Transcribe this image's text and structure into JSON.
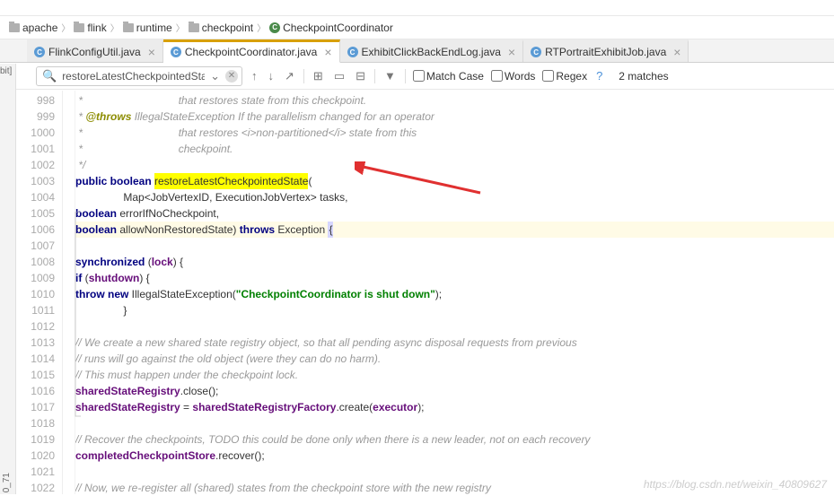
{
  "breadcrumbs": {
    "items": [
      {
        "label": "apache",
        "icon": "folder"
      },
      {
        "label": "flink",
        "icon": "folder"
      },
      {
        "label": "runtime",
        "icon": "folder"
      },
      {
        "label": "checkpoint",
        "icon": "folder"
      },
      {
        "label": "CheckpointCoordinator",
        "icon": "class"
      }
    ]
  },
  "tabs": [
    {
      "label": "FlinkConfigUtil.java",
      "active": false
    },
    {
      "label": "CheckpointCoordinator.java",
      "active": true
    },
    {
      "label": "ExhibitClickBackEndLog.java",
      "active": false
    },
    {
      "label": "RTPortraitExhibitJob.java",
      "active": false
    }
  ],
  "search": {
    "value": "restoreLatestCheckpointedState",
    "match_case_label": "Match Case",
    "words_label": "Words",
    "regex_label": "Regex",
    "matches_label": "2 matches"
  },
  "left_strip_label": "0_71",
  "bit_label": "bit]",
  "lines": [
    {
      "n": "998",
      "indent": 8,
      "tokens": [
        {
          "cls": "c-comment",
          "t": " *                                that restores state from this checkpoint."
        }
      ]
    },
    {
      "n": "999",
      "indent": 8,
      "tokens": [
        {
          "cls": "c-comment",
          "t": " * "
        },
        {
          "cls": "c-tag",
          "t": "@throws"
        },
        {
          "cls": "c-comment",
          "t": " IllegalStateException If the parallelism changed for an operator"
        }
      ]
    },
    {
      "n": "1000",
      "indent": 8,
      "tokens": [
        {
          "cls": "c-comment",
          "t": " *                                that restores <i>non-partitioned</i> state from this"
        }
      ]
    },
    {
      "n": "1001",
      "indent": 8,
      "tokens": [
        {
          "cls": "c-comment",
          "t": " *                                checkpoint."
        }
      ]
    },
    {
      "n": "1002",
      "indent": 8,
      "tokens": [
        {
          "cls": "c-comment",
          "t": " */"
        }
      ]
    },
    {
      "n": "1003",
      "indent": 8,
      "tokens": [
        {
          "cls": "c-kw",
          "t": "public boolean "
        },
        {
          "cls": "c-hl",
          "t": "restoreLatestCheckpointedState"
        },
        {
          "cls": "",
          "t": "("
        }
      ]
    },
    {
      "n": "1004",
      "indent": 16,
      "tokens": [
        {
          "cls": "",
          "t": "Map<JobVertexID, ExecutionJobVertex> tasks,"
        }
      ]
    },
    {
      "n": "1005",
      "indent": 16,
      "tokens": [
        {
          "cls": "c-kw",
          "t": "boolean"
        },
        {
          "cls": "",
          "t": " errorIfNoCheckpoint,"
        }
      ]
    },
    {
      "n": "1006",
      "indent": 16,
      "hl": true,
      "tokens": [
        {
          "cls": "c-kw",
          "t": "boolean"
        },
        {
          "cls": "",
          "t": " allowNonRestoredState) "
        },
        {
          "cls": "c-kw",
          "t": "throws"
        },
        {
          "cls": "",
          "t": " Exception "
        },
        {
          "cls": "c-paren-hl",
          "t": "{"
        }
      ]
    },
    {
      "n": "1007",
      "indent": 0,
      "tokens": []
    },
    {
      "n": "1008",
      "indent": 12,
      "tokens": [
        {
          "cls": "c-kw",
          "t": "synchronized"
        },
        {
          "cls": "",
          "t": " ("
        },
        {
          "cls": "c-field",
          "t": "lock"
        },
        {
          "cls": "",
          "t": ") {"
        }
      ]
    },
    {
      "n": "1009",
      "indent": 16,
      "tokens": [
        {
          "cls": "c-kw",
          "t": "if"
        },
        {
          "cls": "",
          "t": " ("
        },
        {
          "cls": "c-field",
          "t": "shutdown"
        },
        {
          "cls": "",
          "t": ") {"
        }
      ]
    },
    {
      "n": "1010",
      "indent": 20,
      "tokens": [
        {
          "cls": "c-kw",
          "t": "throw new"
        },
        {
          "cls": "",
          "t": " IllegalStateException("
        },
        {
          "cls": "c-str",
          "t": "\"CheckpointCoordinator is shut down\""
        },
        {
          "cls": "",
          "t": ");"
        }
      ]
    },
    {
      "n": "1011",
      "indent": 16,
      "tokens": [
        {
          "cls": "",
          "t": "}"
        }
      ]
    },
    {
      "n": "1012",
      "indent": 0,
      "tokens": []
    },
    {
      "n": "1013",
      "indent": 16,
      "tokens": [
        {
          "cls": "c-comment",
          "t": "// We create a new shared state registry object, so that all pending async disposal requests from previous"
        }
      ]
    },
    {
      "n": "1014",
      "indent": 16,
      "tokens": [
        {
          "cls": "c-comment",
          "t": "// runs will go against the old object (were they can do no harm)."
        }
      ]
    },
    {
      "n": "1015",
      "indent": 16,
      "tokens": [
        {
          "cls": "c-comment",
          "t": "// This must happen under the checkpoint lock."
        }
      ]
    },
    {
      "n": "1016",
      "indent": 16,
      "tokens": [
        {
          "cls": "c-field",
          "t": "sharedStateRegistry"
        },
        {
          "cls": "",
          "t": ".close();"
        }
      ]
    },
    {
      "n": "1017",
      "indent": 16,
      "tokens": [
        {
          "cls": "c-field",
          "t": "sharedStateRegistry"
        },
        {
          "cls": "",
          "t": " = "
        },
        {
          "cls": "c-field",
          "t": "sharedStateRegistryFactory"
        },
        {
          "cls": "",
          "t": ".create("
        },
        {
          "cls": "c-field",
          "t": "executor"
        },
        {
          "cls": "",
          "t": ");"
        }
      ]
    },
    {
      "n": "1018",
      "indent": 0,
      "tokens": []
    },
    {
      "n": "1019",
      "indent": 16,
      "tokens": [
        {
          "cls": "c-comment",
          "t": "// Recover the checkpoints, TODO this could be done only when there is a new leader, not on each recovery"
        }
      ]
    },
    {
      "n": "1020",
      "indent": 16,
      "tokens": [
        {
          "cls": "c-field",
          "t": "completedCheckpointStore"
        },
        {
          "cls": "",
          "t": ".recover();"
        }
      ]
    },
    {
      "n": "1021",
      "indent": 0,
      "tokens": []
    },
    {
      "n": "1022",
      "indent": 16,
      "tokens": [
        {
          "cls": "c-comment",
          "t": "// Now, we re-register all (shared) states from the checkpoint store with the new registry"
        }
      ]
    }
  ],
  "watermark": "https://blog.csdn.net/weixin_40809627"
}
